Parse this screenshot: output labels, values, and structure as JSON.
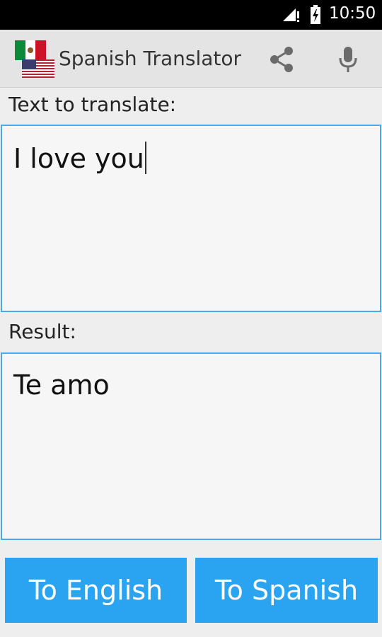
{
  "status_bar": {
    "time": "10:50"
  },
  "app": {
    "title": "Spanish Translator"
  },
  "source": {
    "label": "Text to translate:",
    "value": "I love you"
  },
  "result": {
    "label": "Result:",
    "value": "Te amo"
  },
  "buttons": {
    "to_english": "To English",
    "to_spanish": "To Spanish"
  },
  "colors": {
    "accent": "#2aa3f0",
    "border": "#47a9f0"
  },
  "icons": [
    "signal-icon",
    "battery-charging-icon",
    "mexico-flag-icon",
    "usa-flag-icon",
    "share-icon",
    "mic-icon"
  ]
}
